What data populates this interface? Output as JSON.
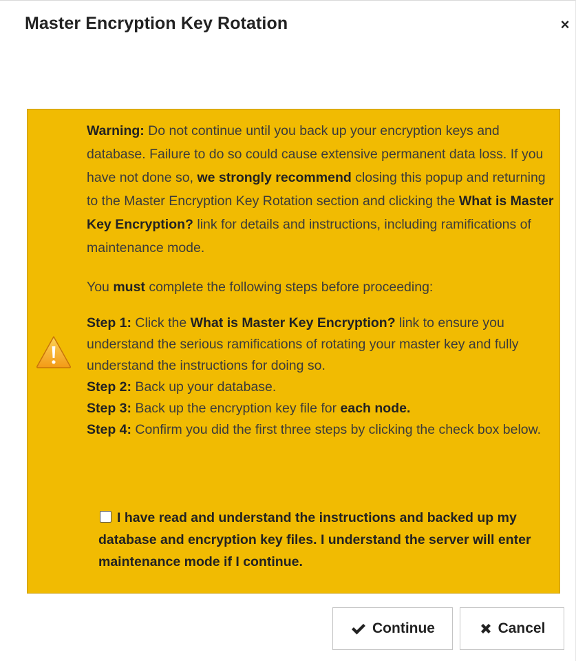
{
  "dialog": {
    "title": "Master Encryption Key Rotation",
    "close_glyph": "×"
  },
  "warning": {
    "icon": "warning-triangle-icon",
    "para1": {
      "lead": "Warning:",
      "t1": " Do not continue until you back up your encryption keys and database. Failure to do so could cause extensive permanent data loss. If you have not done so, ",
      "b1": "we strongly recommend",
      "t2": " closing this popup and returning to the Master Encryption Key Rotation section and clicking the ",
      "b2": "What is Master Key Encryption?",
      "t3": " link for details and instructions, including ramifications of maintenance mode."
    },
    "para2": {
      "t1": "You ",
      "b1": "must",
      "t2": " complete the following steps before proceeding:"
    },
    "steps": [
      {
        "label": "Step 1:",
        "t1": " Click the ",
        "b1": "What is Master Key Encryption?",
        "t2": " link to ensure you understand the serious ramifications of rotating your master key and fully understand the instructions for doing so."
      },
      {
        "label": "Step 2:",
        "t1": " Back up your database."
      },
      {
        "label": "Step 3:",
        "t1": " Back up the encryption key file for ",
        "b1": "each node."
      },
      {
        "label": "Step 4:",
        "t1": " Confirm you did the first three steps by clicking the check box below."
      }
    ],
    "checkbox": {
      "checked": false,
      "label": "I have read and understand the instructions and backed up my database and encryption key files. I understand the server will enter maintenance mode if I continue."
    }
  },
  "buttons": {
    "continue": {
      "label": "Continue",
      "icon": "checkmark-icon"
    },
    "cancel": {
      "label": "Cancel",
      "icon": "x-icon"
    }
  },
  "colors": {
    "warning_bg": "#f1bb02",
    "warning_border": "#c99a00",
    "icon_fill": "#f6a21c"
  }
}
